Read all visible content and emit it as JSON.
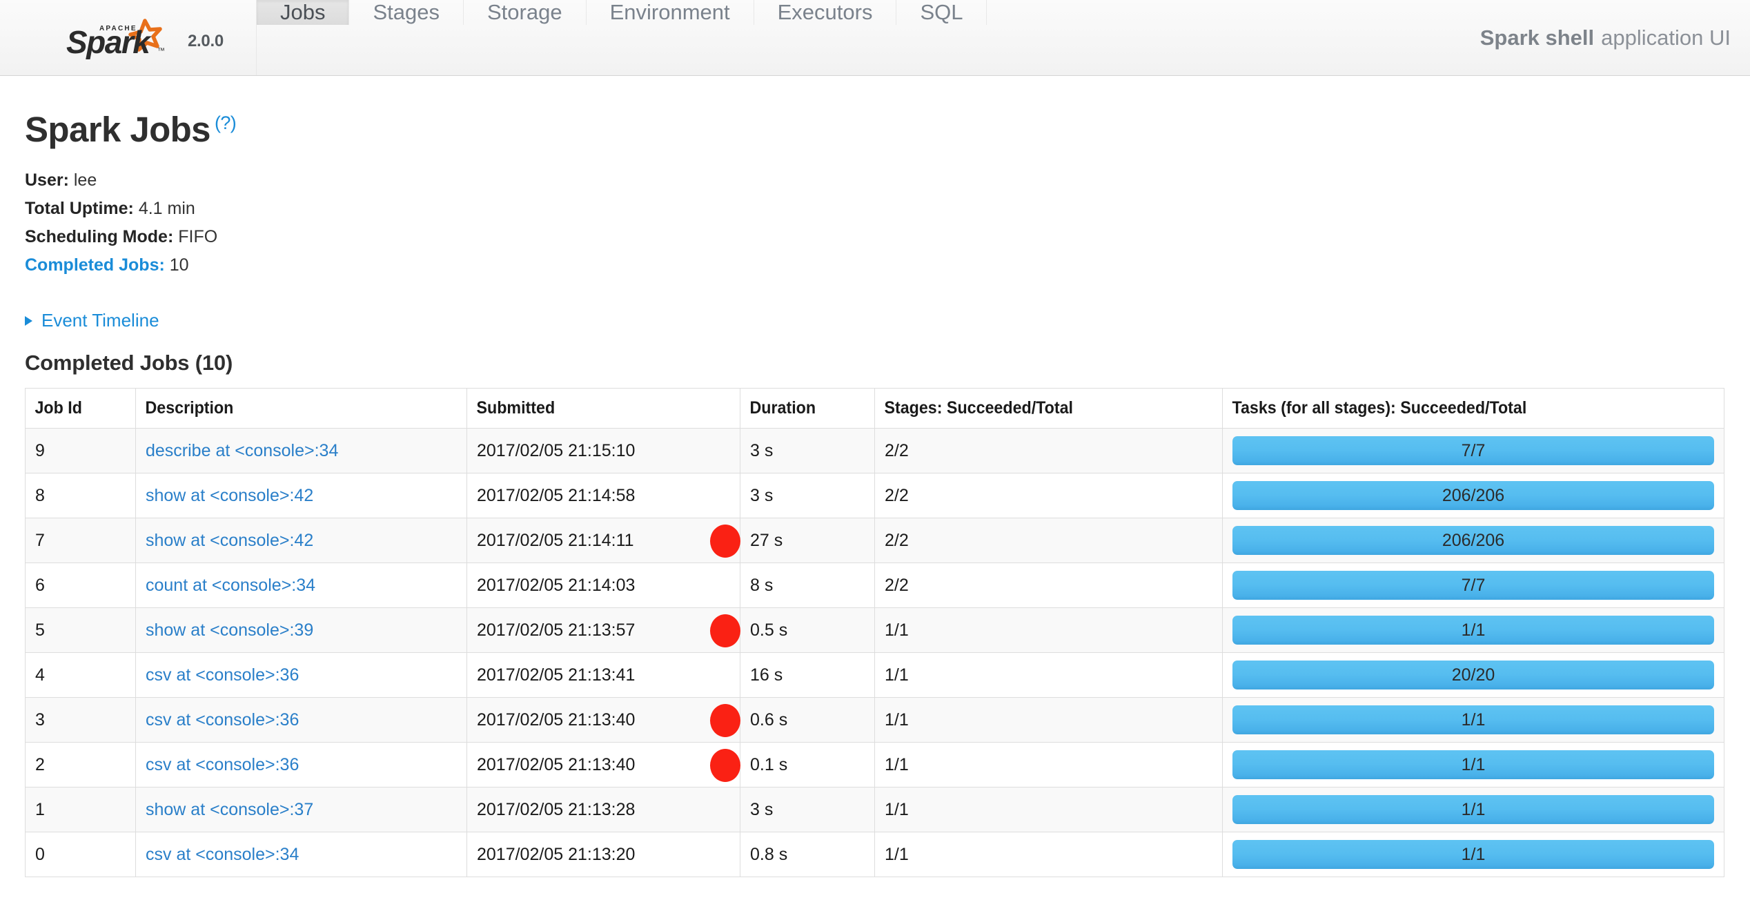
{
  "navbar": {
    "logo_text": "Apache Spark",
    "version": "2.0.0",
    "tabs": [
      {
        "label": "Jobs",
        "active": true
      },
      {
        "label": "Stages",
        "active": false
      },
      {
        "label": "Storage",
        "active": false
      },
      {
        "label": "Environment",
        "active": false
      },
      {
        "label": "Executors",
        "active": false
      },
      {
        "label": "SQL",
        "active": false
      }
    ],
    "app_title_strong": "Spark shell",
    "app_title_rest": "application UI"
  },
  "page": {
    "title": "Spark Jobs",
    "help_label": "(?)",
    "summary": {
      "user_label": "User:",
      "user_value": "lee",
      "uptime_label": "Total Uptime:",
      "uptime_value": "4.1 min",
      "scheduling_label": "Scheduling Mode:",
      "scheduling_value": "FIFO",
      "completed_label": "Completed Jobs:",
      "completed_value": "10"
    },
    "event_timeline_label": "Event Timeline",
    "section_title": "Completed Jobs (10)"
  },
  "table": {
    "columns": [
      "Job Id",
      "Description",
      "Submitted",
      "Duration",
      "Stages: Succeeded/Total",
      "Tasks (for all stages): Succeeded/Total"
    ],
    "rows": [
      {
        "job_id": "9",
        "description": "describe at <console>:34",
        "submitted": "2017/02/05 21:15:10",
        "duration": "3 s",
        "stages": "2/2",
        "tasks": "7/7",
        "tasks_pct": 100,
        "marked": false
      },
      {
        "job_id": "8",
        "description": "show at <console>:42",
        "submitted": "2017/02/05 21:14:58",
        "duration": "3 s",
        "stages": "2/2",
        "tasks": "206/206",
        "tasks_pct": 100,
        "marked": false
      },
      {
        "job_id": "7",
        "description": "show at <console>:42",
        "submitted": "2017/02/05 21:14:11",
        "duration": "27 s",
        "stages": "2/2",
        "tasks": "206/206",
        "tasks_pct": 100,
        "marked": true
      },
      {
        "job_id": "6",
        "description": "count at <console>:34",
        "submitted": "2017/02/05 21:14:03",
        "duration": "8 s",
        "stages": "2/2",
        "tasks": "7/7",
        "tasks_pct": 100,
        "marked": false
      },
      {
        "job_id": "5",
        "description": "show at <console>:39",
        "submitted": "2017/02/05 21:13:57",
        "duration": "0.5 s",
        "stages": "1/1",
        "tasks": "1/1",
        "tasks_pct": 100,
        "marked": true
      },
      {
        "job_id": "4",
        "description": "csv at <console>:36",
        "submitted": "2017/02/05 21:13:41",
        "duration": "16 s",
        "stages": "1/1",
        "tasks": "20/20",
        "tasks_pct": 100,
        "marked": false
      },
      {
        "job_id": "3",
        "description": "csv at <console>:36",
        "submitted": "2017/02/05 21:13:40",
        "duration": "0.6 s",
        "stages": "1/1",
        "tasks": "1/1",
        "tasks_pct": 100,
        "marked": true
      },
      {
        "job_id": "2",
        "description": "csv at <console>:36",
        "submitted": "2017/02/05 21:13:40",
        "duration": "0.1 s",
        "stages": "1/1",
        "tasks": "1/1",
        "tasks_pct": 100,
        "marked": true
      },
      {
        "job_id": "1",
        "description": "show at <console>:37",
        "submitted": "2017/02/05 21:13:28",
        "duration": "3 s",
        "stages": "1/1",
        "tasks": "1/1",
        "tasks_pct": 100,
        "marked": false
      },
      {
        "job_id": "0",
        "description": "csv at <console>:34",
        "submitted": "2017/02/05 21:13:20",
        "duration": "0.8 s",
        "stages": "1/1",
        "tasks": "1/1",
        "tasks_pct": 100,
        "marked": false
      }
    ]
  },
  "colors": {
    "link": "#1a8cd8",
    "job_link": "#2a7fc9",
    "progress_fill": "#56bdf0",
    "annotation_dot": "#fa2114",
    "logo_star": "#e8701a"
  }
}
